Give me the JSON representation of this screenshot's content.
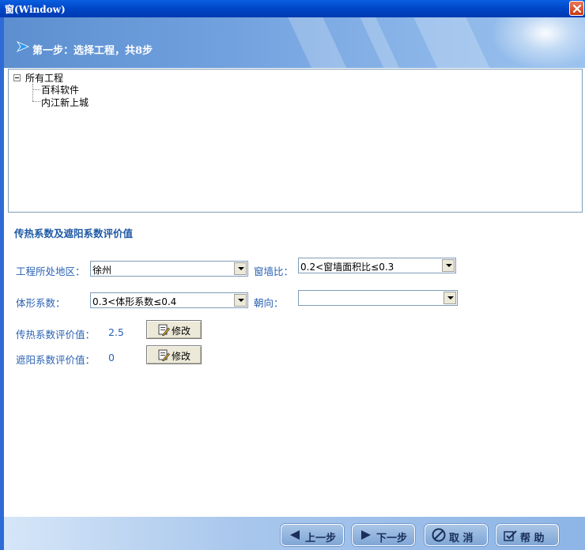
{
  "window": {
    "title": "窗(Window)"
  },
  "banner": {
    "step_title": "第一步：选择工程，共8步"
  },
  "tree": {
    "root": "所有工程",
    "children": [
      "百科软件",
      "内江新上城"
    ]
  },
  "section": {
    "title": "传热系数及遮阳系数评价值"
  },
  "form": {
    "region_label": "工程所处地区：",
    "region_value": "徐州",
    "ratio_label": "窗墙比：",
    "ratio_value": "0.2<窗墙面积比≤0.3",
    "shape_label": "体形系数：",
    "shape_value": "0.3<体形系数≤0.4",
    "orient_label": "朝向：",
    "orient_value": "",
    "heat_label": "传热系数评价值：",
    "heat_value": "2.5",
    "shade_label": "遮阳系数评价值：",
    "shade_value": "0",
    "modify_label": "修改"
  },
  "footer": {
    "prev": "上一步",
    "next": "下一步",
    "cancel": "取 消",
    "help": "帮 助"
  },
  "icons": [
    "close-icon",
    "step-arrow-icon",
    "edit-icon",
    "left-arrow-icon",
    "right-arrow-icon",
    "cancel-icon",
    "help-icon"
  ]
}
